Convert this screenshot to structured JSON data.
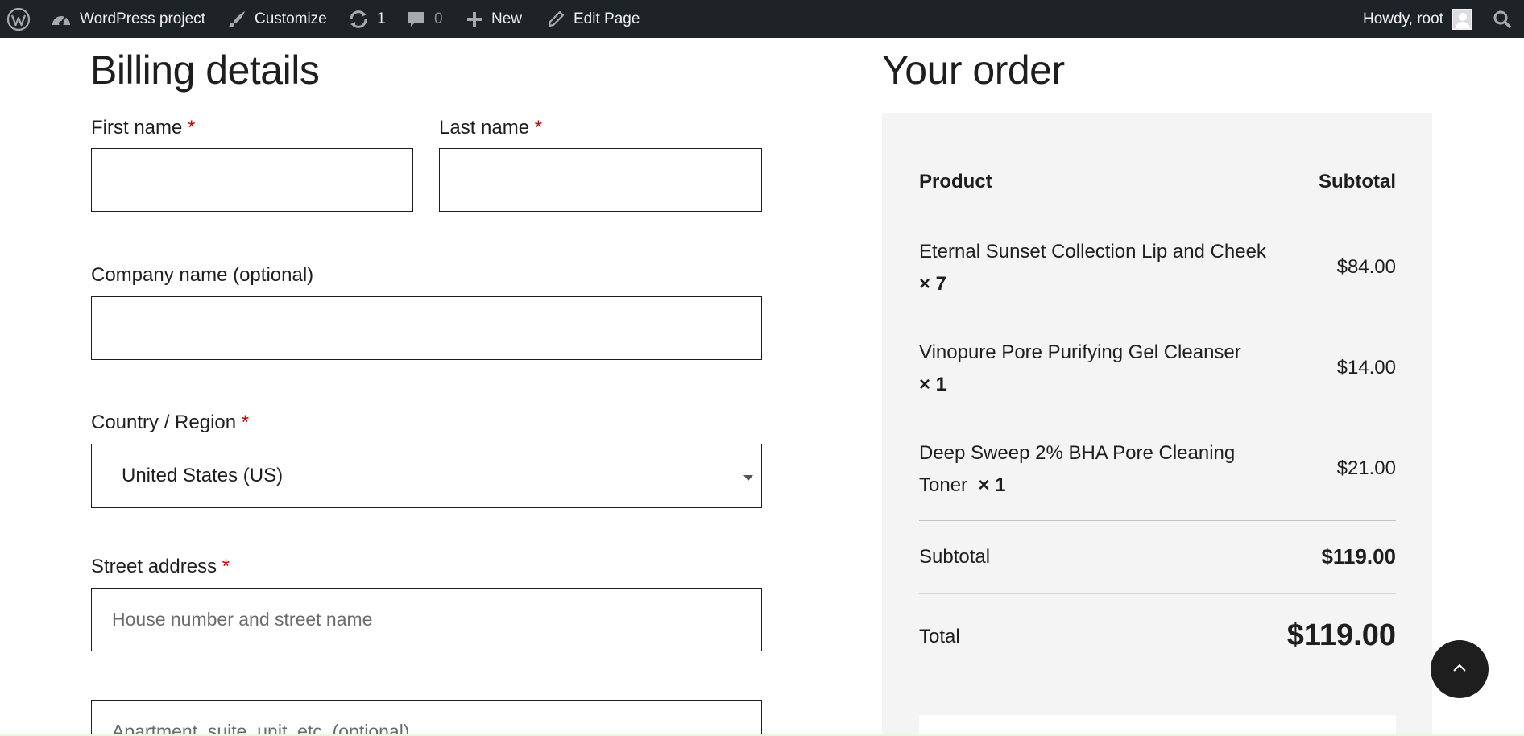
{
  "adminbar": {
    "site_name": "WordPress project",
    "customize": "Customize",
    "updates_count": "1",
    "comments_count": "0",
    "new_label": "New",
    "edit_page": "Edit Page",
    "howdy": "Howdy, root"
  },
  "billing": {
    "title": "Billing details",
    "required_mark": "*",
    "first_name_label": "First name",
    "last_name_label": "Last name",
    "company_label": "Company name (optional)",
    "country_label": "Country / Region",
    "country_value": "United States (US)",
    "street_label": "Street address",
    "street_placeholder": "House number and street name",
    "apartment_placeholder": "Apartment, suite, unit, etc. (optional)"
  },
  "order": {
    "title": "Your order",
    "col_product": "Product",
    "col_subtotal": "Subtotal",
    "items": [
      {
        "line1": "Eternal Sunset Collection Lip and Cheek",
        "line2": "",
        "qty": "× 7",
        "price": "$84.00"
      },
      {
        "line1": "Vinopure Pore Purifying Gel Cleanser",
        "line2": "",
        "qty": "× 1",
        "price": "$14.00"
      },
      {
        "line1": "Deep Sweep 2% BHA Pore Cleaning",
        "line2": "Toner",
        "qty": "× 1",
        "price": "$21.00"
      }
    ],
    "subtotal_label": "Subtotal",
    "subtotal_value": "$119.00",
    "total_label": "Total",
    "total_value": "$119.00"
  },
  "colors": {
    "adminbar_bg": "#1d2327",
    "required": "#d00000",
    "panel_bg": "#f4f4f4"
  }
}
